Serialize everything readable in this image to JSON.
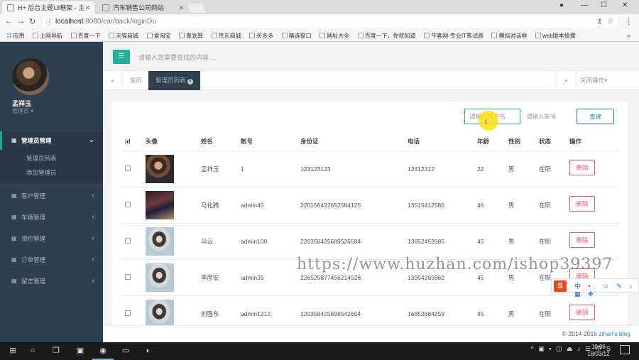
{
  "browser": {
    "tabs": [
      {
        "title": "H+ 后台主题UI框架 - 主"
      },
      {
        "title": "汽车销售公司网站"
      }
    ],
    "url_host": "localhost",
    "url_path": ":8080/car/back/loginDo",
    "bookmarks": [
      "应用",
      "上网导航",
      "百度一下",
      "天猫商城",
      "爱淘宝",
      "聚划算",
      "京东商城",
      "买多多",
      "精选窗口",
      "网址大全",
      "百度一下，你就知道",
      "牛客网-专业IT笔试面",
      "模拟对话框",
      "web版本插拔"
    ],
    "more": "»"
  },
  "sidebar": {
    "user_name": "孟祥玉",
    "user_role": "管理员",
    "active_menu": "管理员管理",
    "submenu": [
      "管理员列表",
      "添加管理员"
    ],
    "menu": [
      "客户管理",
      "车辆管理",
      "预约管理",
      "订单管理",
      "留言管理"
    ]
  },
  "topbar": {
    "search_placeholder": "请输入您需要查找的内容 …"
  },
  "tabs": {
    "home": "首页",
    "active": "管理员列表",
    "close_ops": "关闭操作"
  },
  "filter": {
    "username_placeholder": "请输入用户名",
    "account_placeholder": "请输入账号",
    "query_label": "查询"
  },
  "table": {
    "headers": {
      "id": "id",
      "avatar": "头像",
      "name": "姓名",
      "account": "账号",
      "idcard": "身份证",
      "phone": "电话",
      "age": "年龄",
      "gender": "性别",
      "status": "状态",
      "ops": "操作"
    },
    "rows": [
      {
        "name": "孟祥玉",
        "account": "1",
        "idcard": "123123123",
        "phone": "12412312",
        "age": "22",
        "gender": "男",
        "status": "在职",
        "action": "删除",
        "avatar": "male-1"
      },
      {
        "name": "马化腾",
        "account": "admin45",
        "idcard": "220156422652584125",
        "phone": "13515412586",
        "age": "46",
        "gender": "男",
        "status": "在职",
        "action": "删除",
        "avatar": "male-2"
      },
      {
        "name": "马云",
        "account": "admin100",
        "idcard": "220358425689526584",
        "phone": "13652452685",
        "age": "45",
        "gender": "男",
        "status": "在职",
        "action": "删除",
        "avatar": "female"
      },
      {
        "name": "李彦宏",
        "account": "admin35",
        "idcard": "226525877456214526",
        "phone": "13954265862",
        "age": "45",
        "gender": "男",
        "status": "在职",
        "action": "删除",
        "avatar": "female"
      },
      {
        "name": "刘强东",
        "account": "admin1212",
        "idcard": "220358425698542654",
        "phone": "16852684259",
        "age": "45",
        "gender": "男",
        "status": "在职",
        "action": "删除",
        "avatar": "female"
      }
    ]
  },
  "footer": {
    "copy": "© 2014-2015 ",
    "link": "zihan's blog"
  },
  "watermark": "https://www.huzhan.com/ishop39397",
  "ime": {
    "logo": "S",
    "tools": "中 •, ☺ ✎ ♪ ▦ ✥"
  },
  "taskbar": {
    "time": "10:06",
    "date": "18/03/12"
  }
}
